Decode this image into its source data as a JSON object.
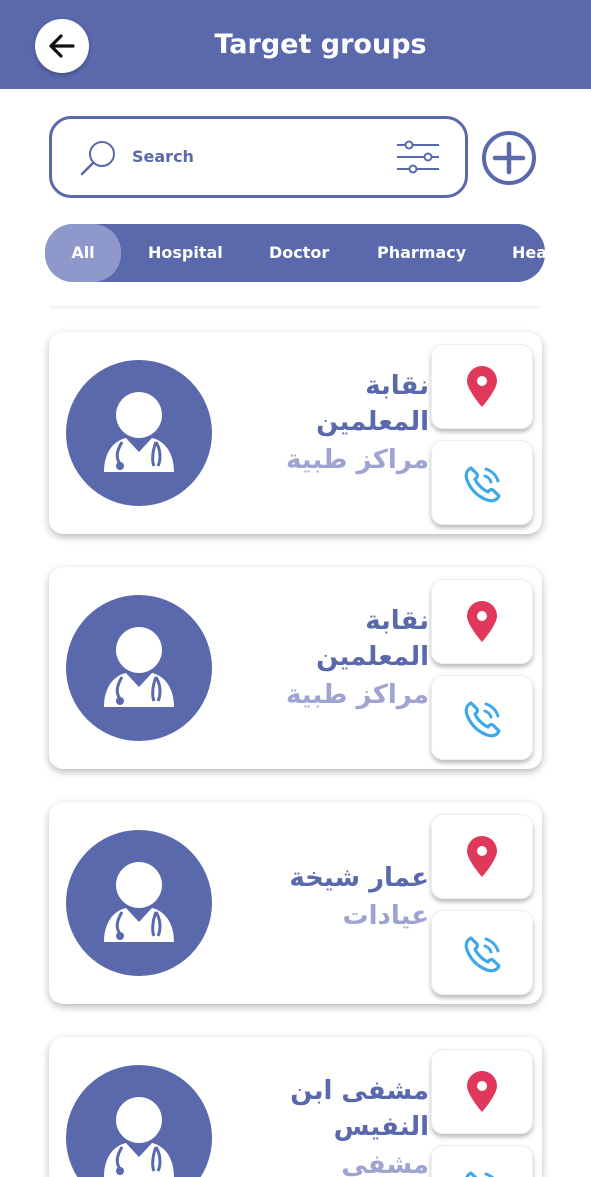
{
  "header": {
    "title": "Target groups",
    "back_icon": "arrow-left-icon"
  },
  "search": {
    "placeholder": "Search",
    "search_icon": "magnifier-icon",
    "filter_icon": "sliders-icon"
  },
  "add_button": {
    "icon": "plus-circle-icon"
  },
  "filters": {
    "items": [
      {
        "label": "All",
        "active": true
      },
      {
        "label": "Hospital",
        "active": false
      },
      {
        "label": "Doctor",
        "active": false
      },
      {
        "label": "Pharmacy",
        "active": false
      },
      {
        "label": "Hea",
        "active": false
      }
    ]
  },
  "colors": {
    "primary": "#5A68AC",
    "active_chip": "#8F98CB",
    "category_text": "#9EA4CF",
    "location_pin": "#E0385A",
    "phone": "#3FA8E8"
  },
  "cards": [
    {
      "name_line1": "نقابة",
      "name_line2": "المعلمين",
      "category": "مراكز طبية",
      "avatar_icon": "doctor-icon",
      "location_icon": "location-pin-icon",
      "call_icon": "phone-call-icon"
    },
    {
      "name_line1": "نقابة",
      "name_line2": "المعلمين",
      "category": "مراكز طبية",
      "avatar_icon": "doctor-icon",
      "location_icon": "location-pin-icon",
      "call_icon": "phone-call-icon"
    },
    {
      "name_line1": "عمار شيخة",
      "name_line2": "",
      "category": "عيادات",
      "avatar_icon": "doctor-icon",
      "location_icon": "location-pin-icon",
      "call_icon": "phone-call-icon"
    },
    {
      "name_line1": "مشفى ابن",
      "name_line2": "النفيس",
      "category": "مشفى",
      "avatar_icon": "doctor-icon",
      "location_icon": "location-pin-icon",
      "call_icon": "phone-call-icon"
    }
  ]
}
